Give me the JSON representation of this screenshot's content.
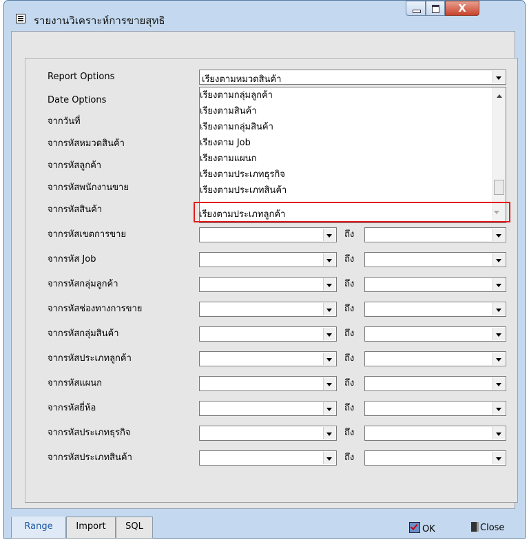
{
  "window": {
    "title": "รายงานวิเคราะห์การขายสุทธิ",
    "close_glyph": "X"
  },
  "form": {
    "report_options_label": "Report Options",
    "report_options_value": "เรียงตามหมวดสินค้า",
    "date_options_label": "Date Options",
    "to_label": "ถึง",
    "range_rows": [
      "จากวันที่",
      "จากรหัสหมวดสินค้า",
      "จากรหัสลูกค้า",
      "จากรหัสพนักงานขาย",
      "จากรหัสสินค้า",
      "จากรหัสเขตการขาย",
      "จากรหัส Job",
      "จากรหัสกลุ่มลูกค้า",
      "จากรหัสช่องทางการขาย",
      "จากรหัสกลุ่มสินค้า",
      "จากรหัสประเภทลูกค้า",
      "จากรหัสแผนก",
      "จากรหัสยี่ห้อ",
      "จากรหัสประเภทธุรกิจ",
      "จากรหัสประเภทสินค้า"
    ]
  },
  "dropdown": {
    "options": [
      "เรียงตามกลุ่มลูกค้า",
      "เรียงตามสินค้า",
      "เรียงตามกลุ่มสินค้า",
      "เรียงตาม Job",
      "เรียงตามแผนก",
      "เรียงตามประเภทธุรกิจ",
      "เรียงตามประเภทสินค้า"
    ],
    "highlighted_option": "เรียงตามประเภทลูกค้า"
  },
  "tabs": [
    "Range",
    "Import",
    "SQL"
  ],
  "buttons": {
    "ok": "OK",
    "close": "Close"
  },
  "colors": {
    "highlight": "#e31b1b",
    "active_tab_text": "#1f5aa8"
  }
}
